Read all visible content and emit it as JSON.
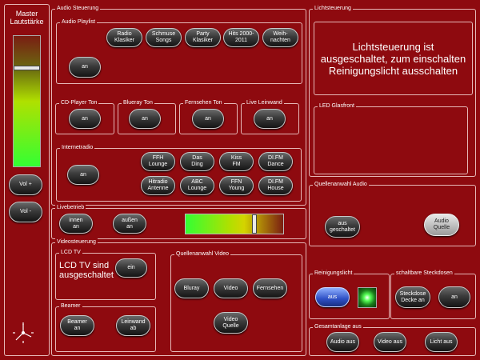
{
  "master": {
    "title": "Master\nLautstärke",
    "volume_level": 0.77,
    "vol_up": "Vol +",
    "vol_down": "Vol -"
  },
  "audio": {
    "title": "Audio Steuerung",
    "playlist": {
      "title": "Audio Playlist",
      "buttons": [
        "Radio\nKlasiker",
        "Schmuse\nSongs",
        "Party\nKlasiker",
        "Hits 2000-\n2011",
        "Weih-\nnachten"
      ],
      "on_label": "an"
    },
    "cd": {
      "title": "CD-Player Ton",
      "on_label": "an"
    },
    "bluray": {
      "title": "Blueray Ton",
      "on_label": "an"
    },
    "tv": {
      "title": "Fernsehen Ton",
      "on_label": "an"
    },
    "live": {
      "title": "Live Leinwand",
      "on_label": "an"
    },
    "internetradio": {
      "title": "Internetradio",
      "on_label": "an",
      "stations": [
        "FFH\nLounge",
        "Das\nDing",
        "Kiss\nFM",
        "DI.FM\nDance",
        "Hitradio\nAntenne",
        "ABC\nLounge",
        "FFN\nYoung",
        "DI.FM\nHouse"
      ]
    }
  },
  "livebetrieb": {
    "title": "Livebetrieb",
    "inside": "innen\nan",
    "outside": "außen\nan",
    "level": 0.68
  },
  "video": {
    "title": "Videosteuerung",
    "lcd": {
      "title": "LCD TV",
      "status": "LCD TV sind\nausgeschaltet",
      "on_label": "ein"
    },
    "beamer": {
      "title": "Beamer",
      "beamer_on": "Beamer\nan",
      "screen_down": "Leinwand\nab"
    },
    "source": {
      "title": "Quellenanwahl Video",
      "buttons": [
        "Bluray",
        "Video",
        "Fernsehen",
        "Video\nQuelle"
      ]
    }
  },
  "light": {
    "title": "Lichtsteuerung",
    "status": "Lichtsteuerung ist\nausgeschaltet, zum einschalten\nReinigungslicht ausschalten",
    "led": {
      "title": "LED Glasfront"
    }
  },
  "audio_source": {
    "title": "Quellenanwahl Audio",
    "off": "aus\ngeschaltet",
    "source": "Audio\nQuelle"
  },
  "cleaning": {
    "title": "Reinigungslicht",
    "off": "aus"
  },
  "sockets": {
    "title": "schaltbare Steckdosen",
    "ceiling": "Steckdose\nDecke an",
    "on": "an"
  },
  "system": {
    "title": "Gesamtanlage aus",
    "audio_off": "Audio aus",
    "video_off": "Video aus",
    "light_off": "Licht aus"
  },
  "colors": {
    "background": "#8e0a0f",
    "border": "#e6b8b8",
    "accent_green": "#33ff33"
  }
}
